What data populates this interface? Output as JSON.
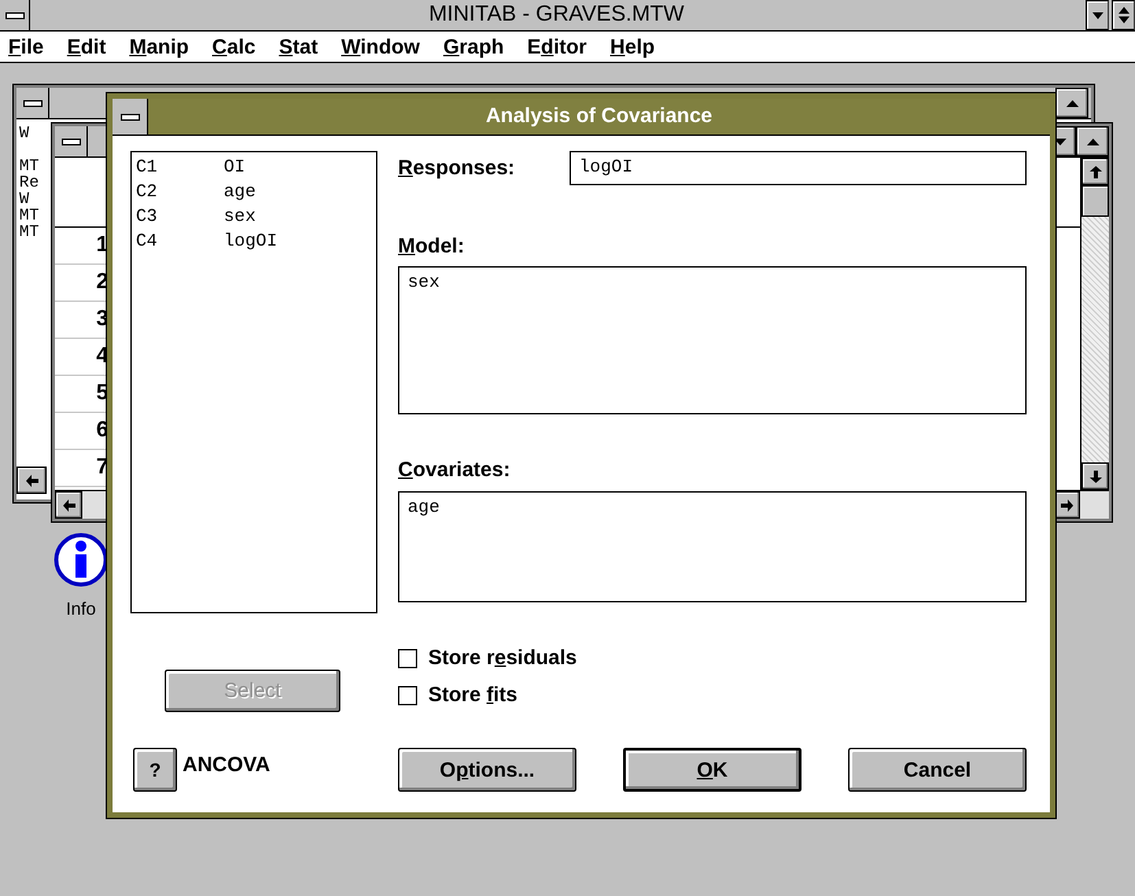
{
  "app": {
    "title": "MINITAB - GRAVES.MTW"
  },
  "menu": [
    {
      "key": "F",
      "post": "ile"
    },
    {
      "key": "E",
      "post": "dit"
    },
    {
      "key": "M",
      "post": "anip"
    },
    {
      "key": "C",
      "post": "alc"
    },
    {
      "key": "S",
      "post": "tat"
    },
    {
      "key": "W",
      "post": "indow"
    },
    {
      "key": "G",
      "post": "raph"
    },
    {
      "pre": "E",
      "key": "d",
      "post": "itor"
    },
    {
      "key": "H",
      "post": "elp"
    }
  ],
  "session_window": {
    "lines": [
      "W",
      "MT",
      "Re",
      "W",
      "MT",
      "MT"
    ]
  },
  "worksheet": {
    "rows": [
      "1",
      "2",
      "3",
      "4",
      "5",
      "6",
      "7"
    ]
  },
  "desktop_icon": {
    "label": "Info"
  },
  "dialog": {
    "title": "Analysis of Covariance",
    "variables": [
      {
        "column": "C1",
        "name": "OI"
      },
      {
        "column": "C2",
        "name": "age"
      },
      {
        "column": "C3",
        "name": "sex"
      },
      {
        "column": "C4",
        "name": "logOI"
      }
    ],
    "select_button": {
      "label": "Select",
      "disabled": true
    },
    "help_button": "?",
    "help_topic": "ANCOVA",
    "responses": {
      "label": {
        "key": "R",
        "post": "esponses:"
      },
      "value": "logOI"
    },
    "model": {
      "label": {
        "key": "M",
        "post": "odel:"
      },
      "value": "sex"
    },
    "covariates": {
      "label": {
        "key": "C",
        "post": "ovariates:"
      },
      "value": "age"
    },
    "options": [
      {
        "label": {
          "pre": "Store r",
          "key": "e",
          "post": "siduals"
        },
        "checked": false
      },
      {
        "label": {
          "pre": "Store ",
          "key": "f",
          "post": "its"
        },
        "checked": false
      }
    ],
    "buttons": [
      {
        "label": {
          "pre": "O",
          "key": "p",
          "post": "tions..."
        },
        "default": false
      },
      {
        "label": {
          "key": "O",
          "post": "K"
        },
        "default": true
      },
      {
        "label": {
          "post": "Cancel"
        },
        "default": false
      }
    ]
  }
}
